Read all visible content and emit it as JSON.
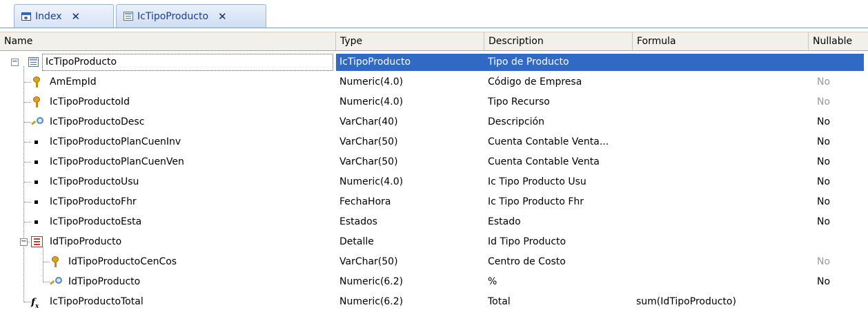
{
  "tabs": [
    {
      "label": "Index",
      "icon": "window-icon",
      "close": "✕"
    },
    {
      "label": "IcTipoProducto",
      "icon": "table-icon",
      "close": "✕"
    }
  ],
  "columns": {
    "name": "Name",
    "type": "Type",
    "description": "Description",
    "formula": "Formula",
    "nullable": "Nullable"
  },
  "rows": [
    {
      "name": "IcTipoProducto",
      "type": "IcTipoProducto",
      "description": "Tipo de  Producto",
      "formula": "",
      "nullable": "",
      "icon": "table-icon",
      "selected": true
    },
    {
      "name": "AmEmpId",
      "type": "Numeric(4.0)",
      "description": "Código de Empresa",
      "formula": "",
      "nullable": "No",
      "icon": "key-icon"
    },
    {
      "name": "IcTipoProductoId",
      "type": "Numeric(4.0)",
      "description": "Tipo Recurso",
      "formula": "",
      "nullable": "No",
      "icon": "key-icon"
    },
    {
      "name": "IcTipoProductoDesc",
      "type": "VarChar(40)",
      "description": "Descripción",
      "formula": "",
      "nullable": "No",
      "icon": "search-icon"
    },
    {
      "name": "IcTipoProductoPlanCuenInv",
      "type": "VarChar(50)",
      "description": "Cuenta Contable Venta...",
      "formula": "",
      "nullable": "No",
      "icon": "bullet-icon"
    },
    {
      "name": "IcTipoProductoPlanCuenVen",
      "type": "VarChar(50)",
      "description": "Cuenta Contable Venta",
      "formula": "",
      "nullable": "No",
      "icon": "bullet-icon"
    },
    {
      "name": "IcTipoProductoUsu",
      "type": "Numeric(4.0)",
      "description": "Ic Tipo Producto Usu",
      "formula": "",
      "nullable": "No",
      "icon": "bullet-icon"
    },
    {
      "name": "IcTipoProductoFhr",
      "type": "FechaHora",
      "description": "Ic Tipo Producto Fhr",
      "formula": "",
      "nullable": "No",
      "icon": "bullet-icon"
    },
    {
      "name": "IcTipoProductoEsta",
      "type": "Estados",
      "description": "Estado",
      "formula": "",
      "nullable": "No",
      "icon": "bullet-icon"
    },
    {
      "name": "IdTipoProducto",
      "type": "Detalle",
      "description": "Id Tipo Producto",
      "formula": "",
      "nullable": "",
      "icon": "level-icon"
    },
    {
      "name": "IdTipoProductoCenCos",
      "type": "VarChar(50)",
      "description": "Centro de Costo",
      "formula": "",
      "nullable": "No",
      "icon": "key-icon"
    },
    {
      "name": "IdTipoProducto",
      "type": "Numeric(6.2)",
      "description": "%",
      "formula": "",
      "nullable": "No",
      "icon": "search-icon"
    },
    {
      "name": "IcTipoProductoTotal",
      "type": "Numeric(6.2)",
      "description": "Total",
      "formula": "sum(IdTipoProducto)",
      "nullable": "",
      "icon": "formula-icon"
    }
  ],
  "colors": {
    "selection": "#316ac5",
    "tab_text": "#1d3d8f",
    "nullable_gray": "#9a9a9a"
  }
}
